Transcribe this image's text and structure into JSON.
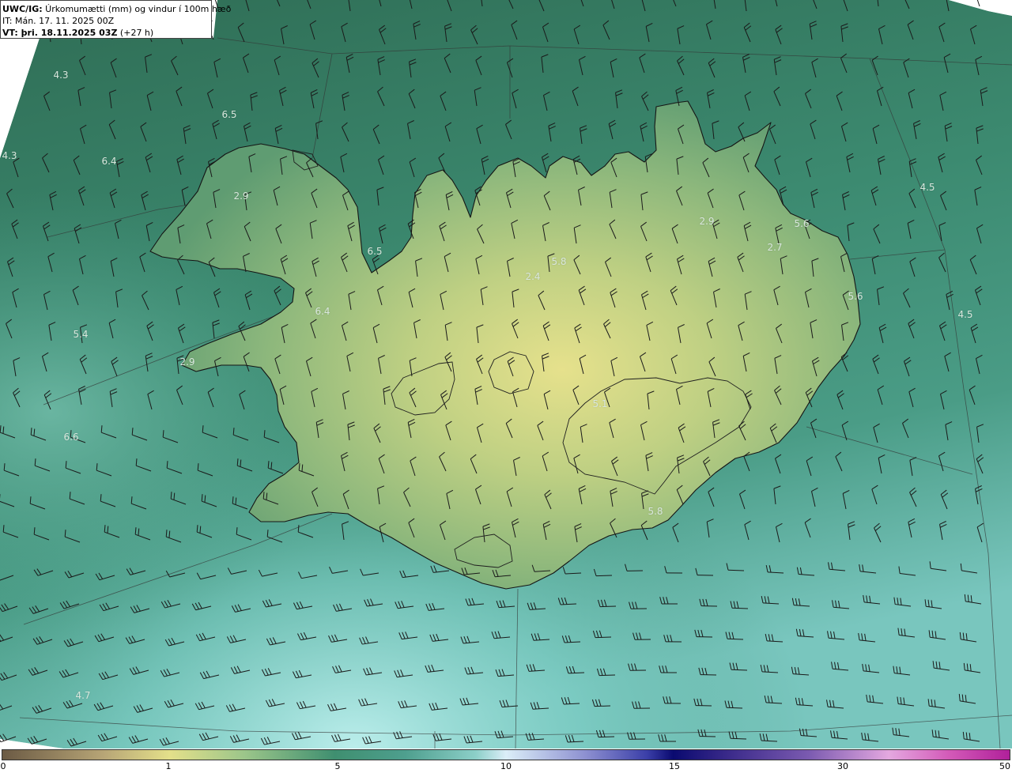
{
  "title": {
    "prefix": "UWC/IG:",
    "text": " Úrkomumætti (mm) og vindur í 100m hæð",
    "it": "IT: Mán. 17. 11. 2025 00Z",
    "vt_prefix": "VT:",
    "vt_bold": " þri. 18.11.2025 03Z",
    "vt_suffix": " (+27 h)"
  },
  "value_labels": [
    "4.3",
    "6.5",
    "4.3",
    "6.4",
    "2.9",
    "6.5",
    "5.8",
    "2.4",
    "2.9",
    "5.6",
    "2.7",
    "4.5",
    "5.6",
    "4.5",
    "5.4",
    "6.4",
    "2.9",
    "6.6",
    "5.1",
    "5.8",
    "4.7"
  ],
  "colorbar": {
    "ticks": [
      "0",
      "1",
      "5",
      "10",
      "15",
      "30",
      "50"
    ]
  },
  "colors": {
    "sea_deep": "#2f6f58",
    "sea_light": "#8fd6cf",
    "land_low": "#6fa877",
    "land_high": "#e2df8a",
    "outline": "#1a1a1a",
    "graticule": "#3a3a3a",
    "barb": "#222222"
  }
}
